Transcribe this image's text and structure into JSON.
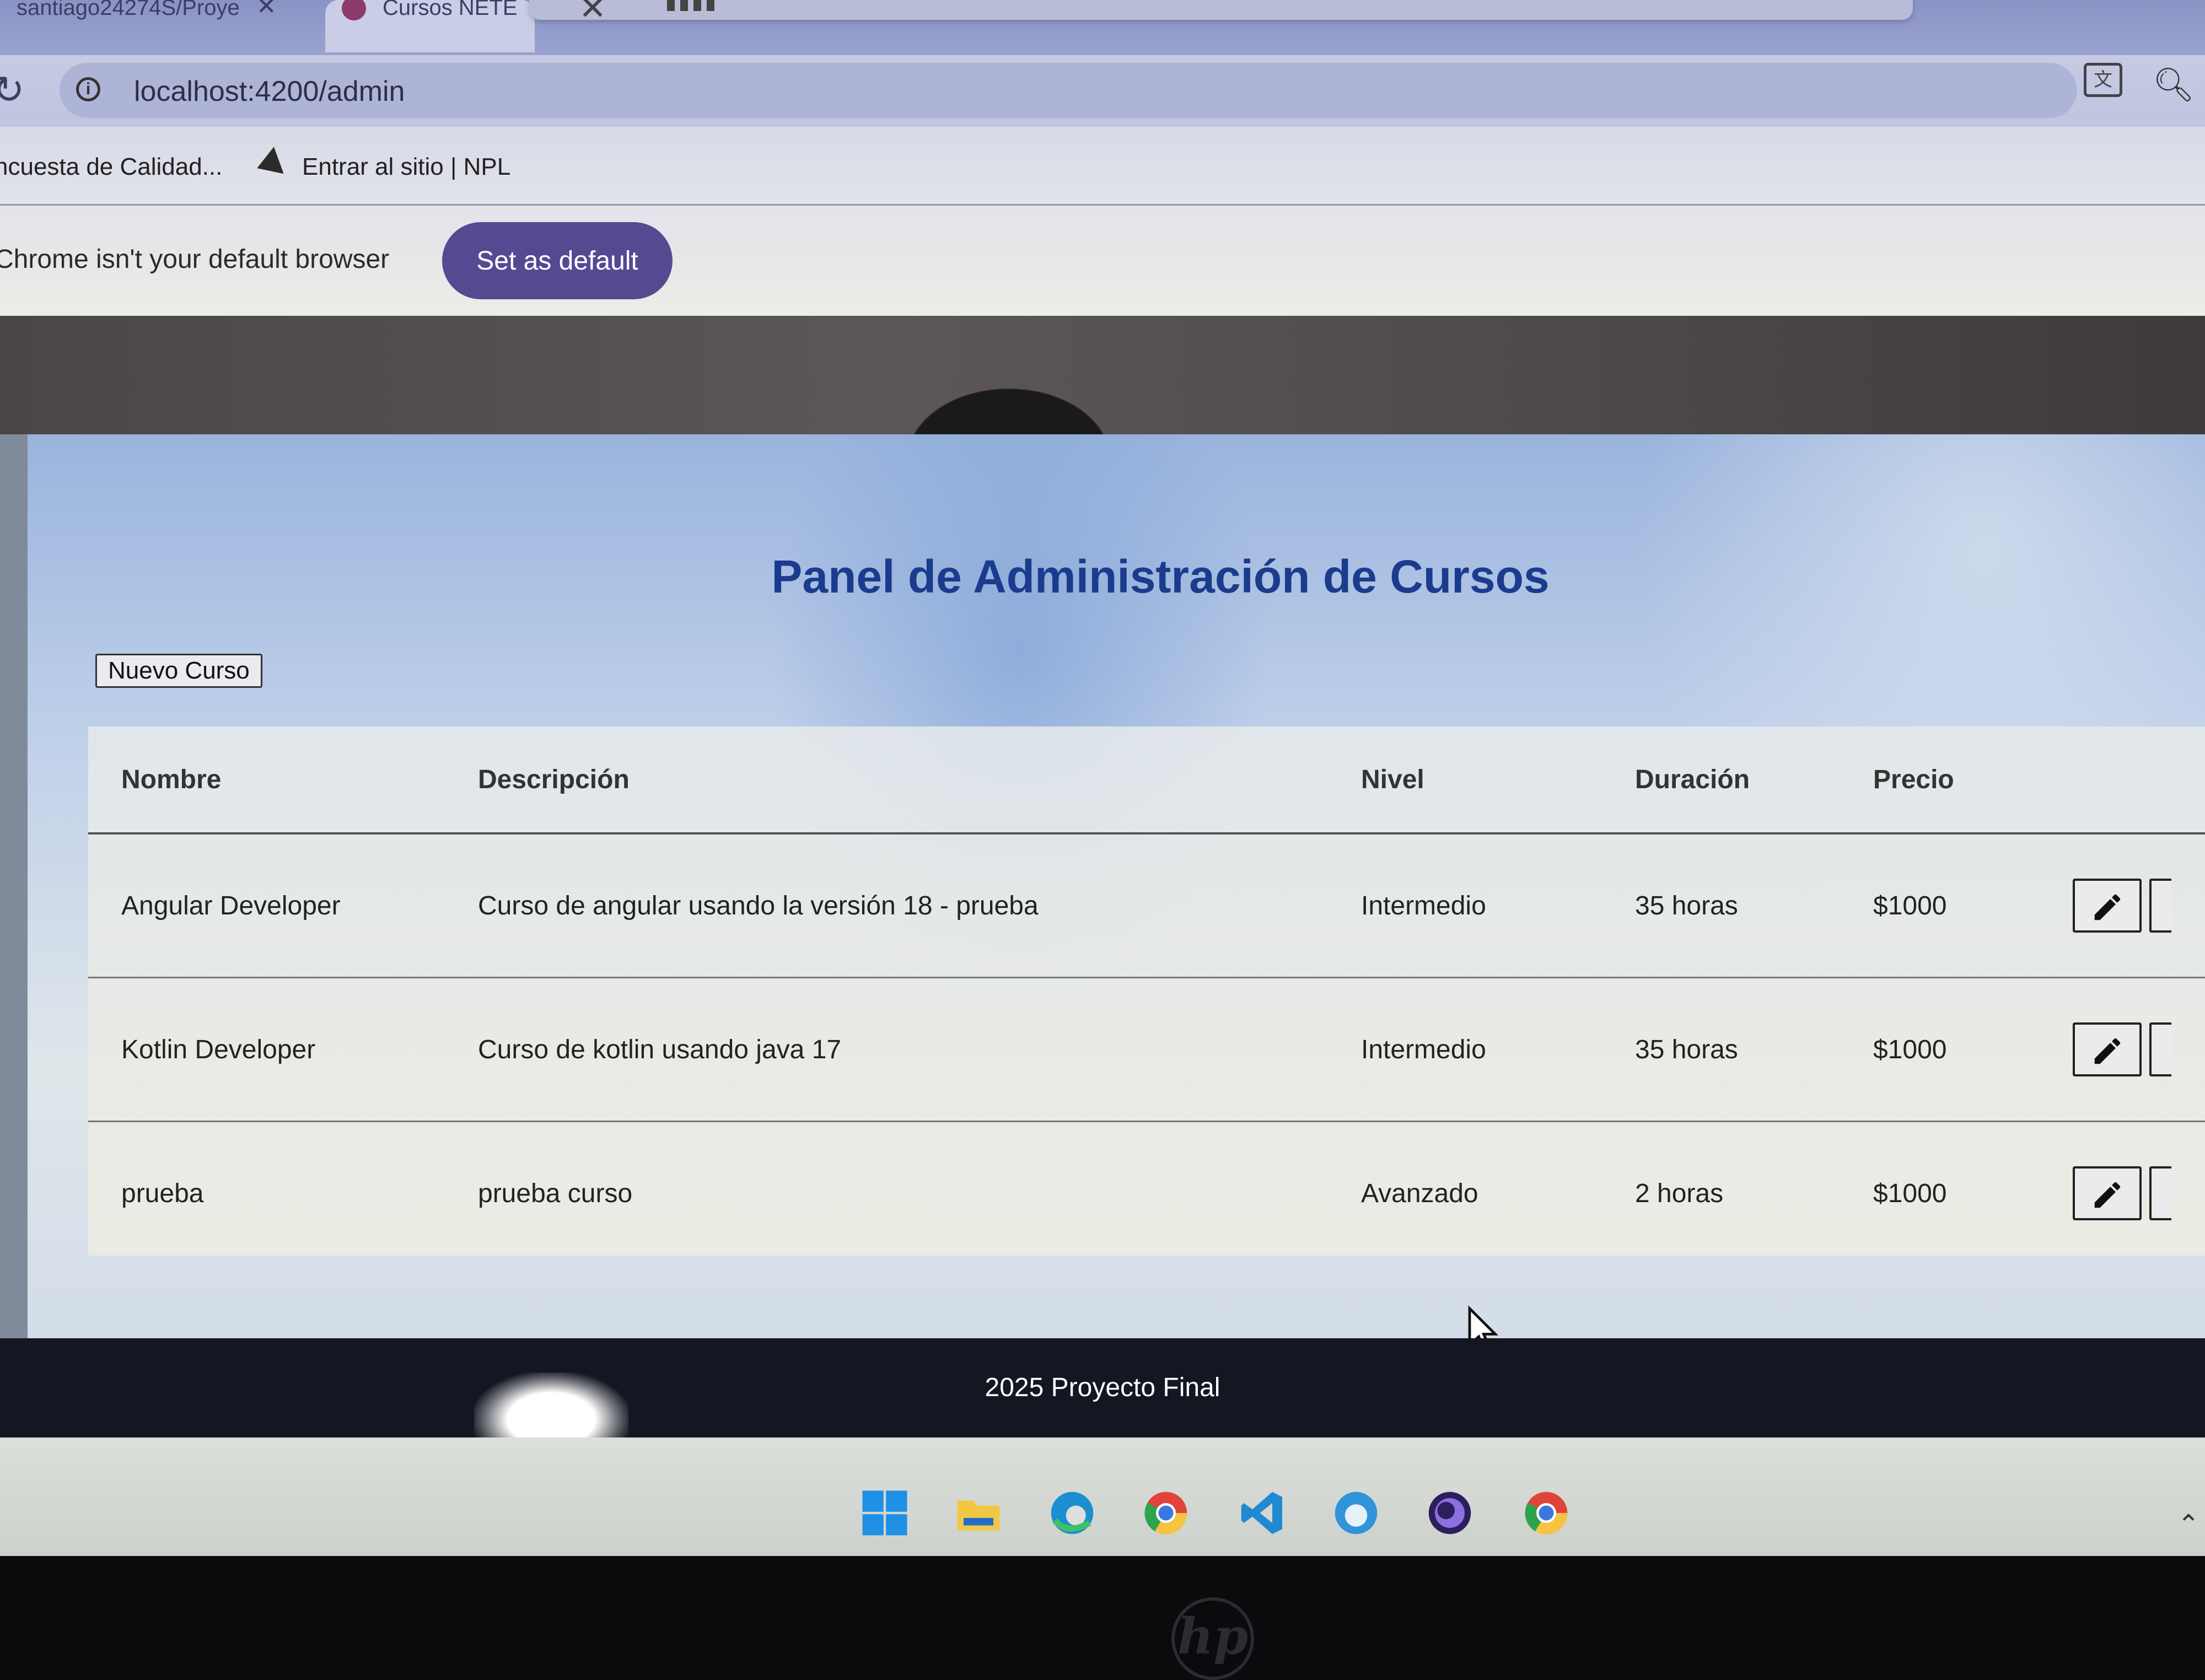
{
  "browser": {
    "tabs": [
      {
        "label": "santiago24274S/Proye"
      },
      {
        "label": "Cursos NETE"
      }
    ],
    "url": "localhost:4200/admin",
    "bookmarks": [
      {
        "label": "ncuesta de Calidad..."
      },
      {
        "label": "Entrar al sitio | NPL"
      }
    ],
    "infobar": {
      "message": "Chrome isn't your default browser",
      "button_label": "Set as default"
    }
  },
  "page": {
    "title": "Panel de Administración de Cursos",
    "new_button": "Nuevo Curso",
    "table": {
      "headers": [
        "Nombre",
        "Descripción",
        "Nivel",
        "Duración",
        "Precio"
      ],
      "rows": [
        {
          "name": "Angular Developer",
          "description": "Curso de angular usando la versión 18 - prueba",
          "level": "Intermedio",
          "duration": "35 horas",
          "price": "$1000"
        },
        {
          "name": "Kotlin Developer",
          "description": "Curso de kotlin usando java 17",
          "level": "Intermedio",
          "duration": "35 horas",
          "price": "$1000"
        },
        {
          "name": "prueba",
          "description": "prueba curso",
          "level": "Avanzado",
          "duration": "2 horas",
          "price": "$1000"
        }
      ]
    },
    "footer": "2025 Proyecto Final"
  },
  "taskbar": {
    "icons": [
      "windows-start-icon",
      "file-explorer-icon",
      "edge-icon",
      "chrome-icon",
      "vscode-icon",
      "app-icon",
      "obs-icon",
      "chrome-icon"
    ]
  },
  "colors": {
    "title": "#1b3b8e",
    "set_default_button": "#544a92",
    "footer": "#141622"
  }
}
